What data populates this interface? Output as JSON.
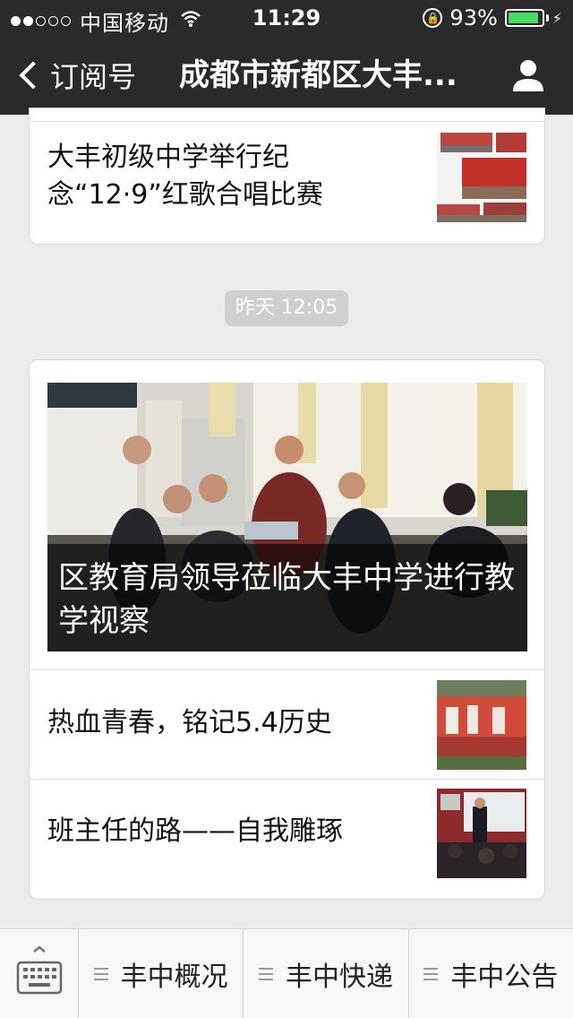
{
  "status": {
    "carrier": "中国移动",
    "time": "11:29",
    "battery": "93%",
    "battery_level": 0.93
  },
  "nav": {
    "back_label": "订阅号",
    "title": "成都市新都区大丰..."
  },
  "articles": {
    "first": {
      "title": "大丰初级中学举行纪念“12·9”红歌合唱比赛"
    },
    "timestamp": "昨天 12:05",
    "cover": {
      "title": "区教育局领导莅临大丰中学进行教学视察"
    },
    "item1": {
      "title": "热血青春，铭记5.4历史"
    },
    "item2": {
      "title": "班主任的路——自我雕琢"
    }
  },
  "menu": {
    "items": [
      "丰中概况",
      "丰中快递",
      "丰中公告"
    ]
  }
}
